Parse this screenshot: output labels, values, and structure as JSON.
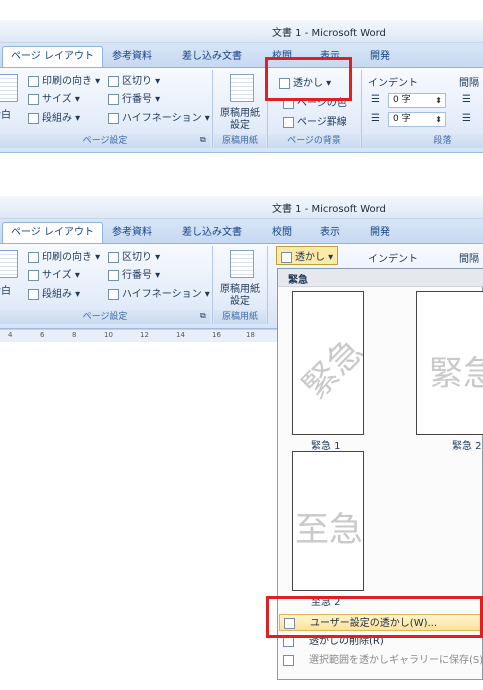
{
  "window": {
    "title": "文書 1 - Microsoft Word"
  },
  "tabs": [
    "ページ レイアウト",
    "参考資料",
    "差し込み文書",
    "校閲",
    "表示",
    "開発"
  ],
  "page_setup": {
    "margin_label": "余白",
    "orientation_label": "印刷の向き",
    "size_label": "サイズ",
    "columns_label": "段組み",
    "breaks_label": "区切り",
    "line_numbers_label": "行番号",
    "hyphenation_label": "ハイフネーション",
    "group_label": "ページ設定"
  },
  "genkou": {
    "line1": "原稿用紙",
    "line2": "設定",
    "group_label": "原稿用紙"
  },
  "page_background": {
    "watermark_label": "透かし",
    "page_color_label": "ページの色",
    "page_borders_label": "ページ罫線",
    "group_label": "ページの背景"
  },
  "paragraph": {
    "indent_label": "インデント",
    "spacing_label": "間隔",
    "indent_left_value": "0 字",
    "indent_right_value": "0 字",
    "group_label": "段落"
  },
  "watermark_menu": {
    "section_header": "緊急",
    "thumbnails": [
      {
        "text": "緊急",
        "caption": "緊急 1"
      },
      {
        "text": "緊急",
        "caption": "緊急 2"
      },
      {
        "text": "至急",
        "caption": "至急 2"
      }
    ],
    "items": [
      "ユーザー設定の透かし(W)...",
      "透かしの削除(R)",
      "選択範囲を透かしギャラリーに保存(S)..."
    ]
  },
  "ruler_ticks": [
    "4",
    "6",
    "8",
    "10",
    "12",
    "14",
    "16",
    "18"
  ],
  "colors": {
    "ribbon_accent": "#8db2e3",
    "highlight": "#e02020",
    "menu_hover": "#fde9a8"
  }
}
